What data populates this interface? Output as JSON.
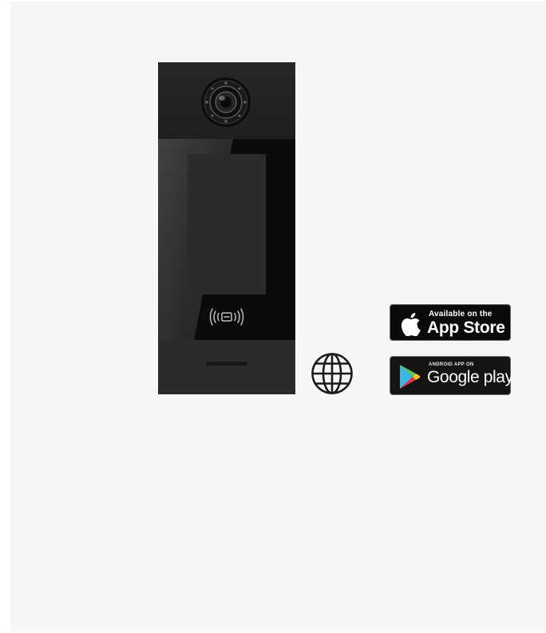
{
  "images": {
    "door_station": "door-station-panel",
    "globe": "globe-icon"
  },
  "badges": {
    "app_store": {
      "small_text": "Available on the",
      "big_text": "App Store",
      "icon": "apple-icon"
    },
    "google_play": {
      "small_text": "ANDROID APP ON",
      "big_text": "Google play",
      "icon": "google-play-icon"
    }
  },
  "colors": {
    "background": "#f5f6f6",
    "panel": "#202121",
    "glass": "#0b0b0c",
    "badge": "#0a0a0a"
  }
}
